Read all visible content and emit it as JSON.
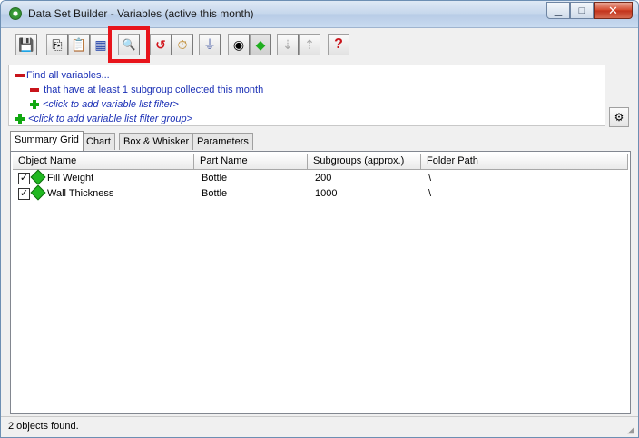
{
  "window": {
    "title": "Data Set Builder - Variables (active this month)",
    "caption_buttons": {
      "minimize": "▁",
      "maximize": "□",
      "close": "✕"
    }
  },
  "toolbar": {
    "buttons": [
      {
        "name": "save-icon",
        "glyph": "💾"
      },
      {
        "name": "copy-icon",
        "glyph": "⎘"
      },
      {
        "name": "paste-icon",
        "glyph": "📋"
      },
      {
        "name": "image-icon",
        "glyph": "▦"
      },
      {
        "name": "print-preview-icon",
        "glyph": "🔍"
      },
      {
        "name": "undo-icon",
        "glyph": "↺"
      },
      {
        "name": "timer-icon",
        "glyph": "⏱"
      },
      {
        "name": "filter-icon",
        "glyph": "⏚"
      },
      {
        "name": "eye-icon",
        "glyph": "◉"
      },
      {
        "name": "variable-icon",
        "glyph": "◆"
      },
      {
        "name": "move-down-icon",
        "glyph": "⇣"
      },
      {
        "name": "move-up-icon",
        "glyph": "⇡"
      },
      {
        "name": "help-icon",
        "glyph": "?"
      }
    ]
  },
  "filters": {
    "root": "Find all variables...",
    "condition": "that have at least 1 subgroup collected this month",
    "add_filter": "<click to add variable list filter>",
    "add_group": "<click to add variable list filter group>"
  },
  "tabs": [
    "Summary Grid",
    "Chart",
    "Box & Whisker",
    "Parameters"
  ],
  "grid": {
    "columns": [
      "Object Name",
      "Part Name",
      "Subgroups (approx.)",
      "Folder Path"
    ],
    "rows": [
      {
        "checked": "✓",
        "object_name": "Fill Weight",
        "part_name": "Bottle",
        "subgroups": "200",
        "folder_path": "\\"
      },
      {
        "checked": "✓",
        "object_name": "Wall Thickness",
        "part_name": "Bottle",
        "subgroups": "1000",
        "folder_path": "\\"
      }
    ]
  },
  "status": {
    "text": "2 objects found."
  },
  "colors": {
    "highlight": "#e8141b",
    "filter_text": "#1a2fb5",
    "add_icon": "#11a811",
    "remove_icon": "#c8141b"
  }
}
